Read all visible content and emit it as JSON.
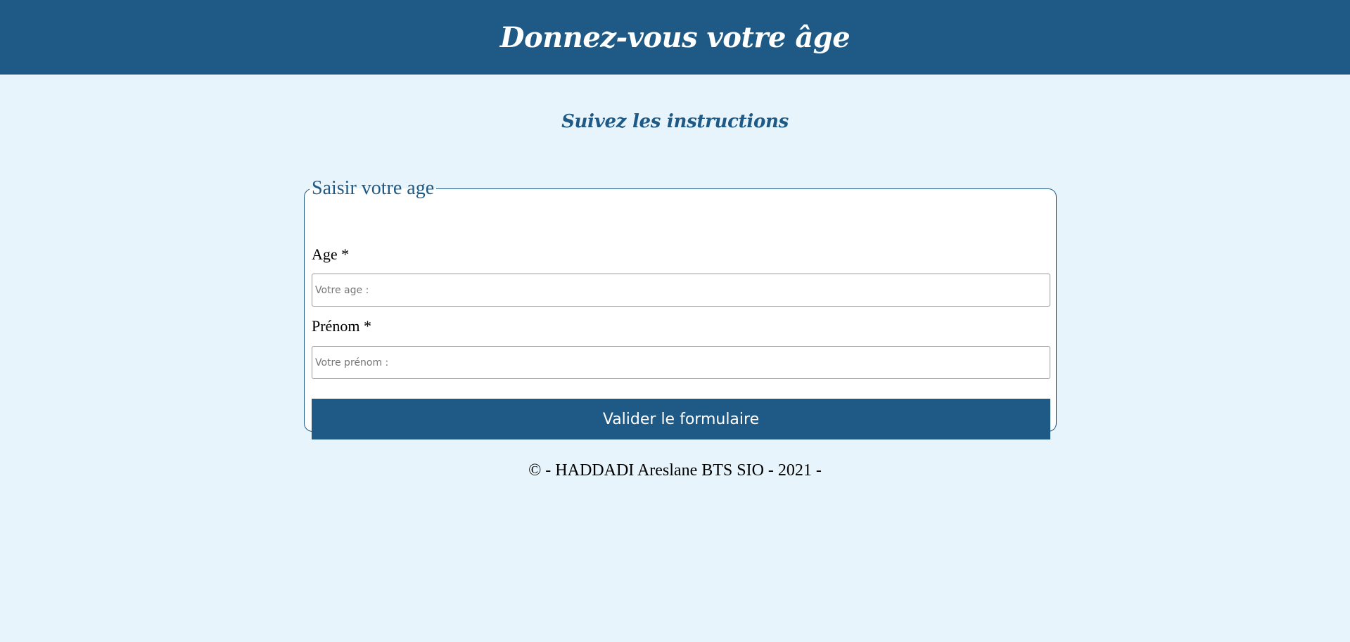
{
  "header": {
    "title": "Donnez-vous votre âge"
  },
  "main": {
    "subtitle": "Suivez les instructions"
  },
  "form": {
    "legend": "Saisir votre age",
    "age_label": "Age *",
    "age_placeholder": "Votre age :",
    "prenom_label": "Prénom *",
    "prenom_placeholder": "Votre prénom :",
    "submit_label": "Valider le formulaire"
  },
  "footer": {
    "text": "© - HADDADI Areslane BTS SIO - 2021 -"
  },
  "colors": {
    "brand": "#1e5a85",
    "background": "#e8f4fb"
  }
}
